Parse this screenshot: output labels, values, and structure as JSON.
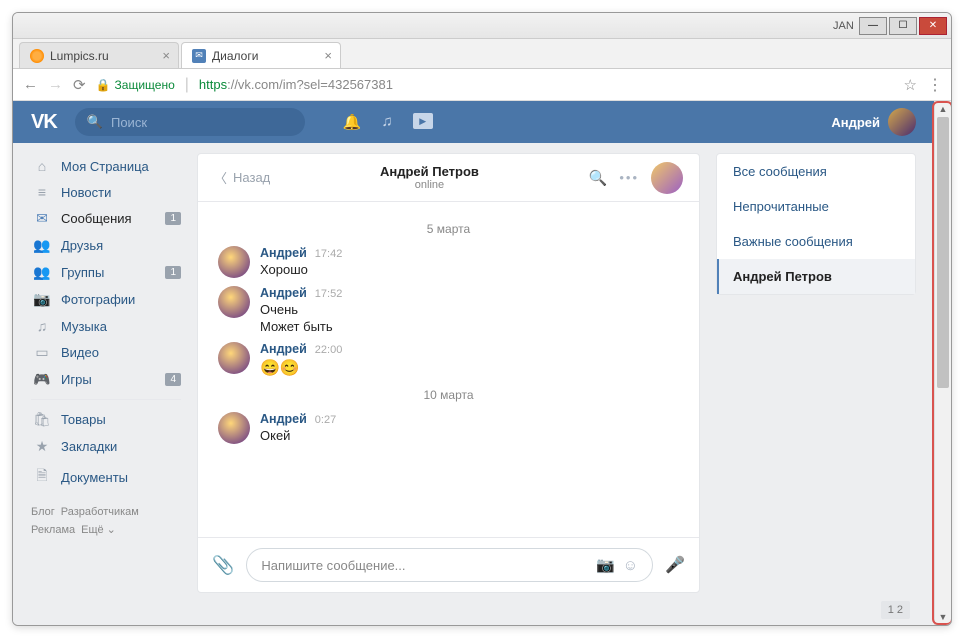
{
  "window": {
    "jan": "JAN"
  },
  "tabs": [
    {
      "title": "Lumpics.ru",
      "active": false,
      "fav": "orange"
    },
    {
      "title": "Диалоги",
      "active": true,
      "fav": "vk"
    }
  ],
  "address": {
    "secure_label": "Защищено",
    "scheme": "https",
    "host": "://vk.com",
    "path": "/im?sel=432567381"
  },
  "header": {
    "search_placeholder": "Поиск",
    "user": "Андрей"
  },
  "nav": [
    {
      "icon": "⌂",
      "label": "Моя Страница"
    },
    {
      "icon": "≡",
      "label": "Новости"
    },
    {
      "icon": "✉",
      "label": "Сообщения",
      "badge": "1",
      "active": true
    },
    {
      "icon": "👥",
      "label": "Друзья"
    },
    {
      "icon": "👥",
      "label": "Группы",
      "badge": "1"
    },
    {
      "icon": "📷",
      "label": "Фотографии"
    },
    {
      "icon": "♫",
      "label": "Музыка"
    },
    {
      "icon": "▭",
      "label": "Видео"
    },
    {
      "icon": "🎮",
      "label": "Игры",
      "badge": "4"
    }
  ],
  "nav2": [
    {
      "icon": "🛍",
      "label": "Товары"
    },
    {
      "icon": "★",
      "label": "Закладки"
    },
    {
      "icon": "🗎",
      "label": "Документы"
    }
  ],
  "footer": {
    "l1a": "Блог",
    "l1b": "Разработчикам",
    "l2a": "Реклама",
    "l2b": "Ещё ⌄"
  },
  "chat": {
    "back": "Назад",
    "title": "Андрей Петров",
    "status": "online",
    "dates": [
      "5 марта",
      "10 марта"
    ],
    "msgs": [
      {
        "name": "Андрей",
        "time": "17:42",
        "text": "Хорошо",
        "d": 0
      },
      {
        "name": "Андрей",
        "time": "17:52",
        "text": "Очень",
        "extra": "Может быть",
        "d": 0
      },
      {
        "name": "Андрей",
        "time": "22:00",
        "emoji": "😄😊",
        "d": 0
      },
      {
        "name": "Андрей",
        "time": "0:27",
        "text": "Окей",
        "d": 1
      }
    ],
    "placeholder": "Напишите сообщение..."
  },
  "filters": [
    {
      "label": "Все сообщения"
    },
    {
      "label": "Непрочитанные"
    },
    {
      "label": "Важные сообщения"
    },
    {
      "label": "Андрей Петров",
      "sel": true
    }
  ],
  "pagenum": "1 2"
}
